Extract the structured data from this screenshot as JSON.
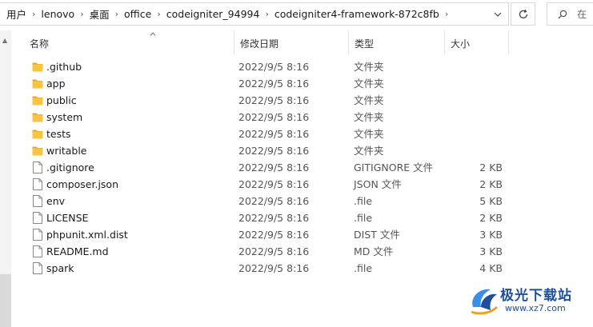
{
  "address": {
    "crumbs": [
      "用户",
      "lenovo",
      "桌面",
      "office",
      "codeigniter_94994",
      "codeigniter4-framework-872c8fb"
    ],
    "separator": "›"
  },
  "search": {
    "placeholder": "在"
  },
  "columns": {
    "name": "名称",
    "date": "修改日期",
    "type": "类型",
    "size": "大小"
  },
  "files": [
    {
      "name": ".github",
      "date": "2022/9/5 8:16",
      "type": "文件夹",
      "size": "",
      "kind": "folder"
    },
    {
      "name": "app",
      "date": "2022/9/5 8:16",
      "type": "文件夹",
      "size": "",
      "kind": "folder"
    },
    {
      "name": "public",
      "date": "2022/9/5 8:16",
      "type": "文件夹",
      "size": "",
      "kind": "folder"
    },
    {
      "name": "system",
      "date": "2022/9/5 8:16",
      "type": "文件夹",
      "size": "",
      "kind": "folder"
    },
    {
      "name": "tests",
      "date": "2022/9/5 8:16",
      "type": "文件夹",
      "size": "",
      "kind": "folder"
    },
    {
      "name": "writable",
      "date": "2022/9/5 8:16",
      "type": "文件夹",
      "size": "",
      "kind": "folder"
    },
    {
      "name": ".gitignore",
      "date": "2022/9/5 8:16",
      "type": "GITIGNORE 文件",
      "size": "2 KB",
      "kind": "file"
    },
    {
      "name": "composer.json",
      "date": "2022/9/5 8:16",
      "type": "JSON 文件",
      "size": "2 KB",
      "kind": "file"
    },
    {
      "name": "env",
      "date": "2022/9/5 8:16",
      "type": ".file",
      "size": "5 KB",
      "kind": "file"
    },
    {
      "name": "LICENSE",
      "date": "2022/9/5 8:16",
      "type": ".file",
      "size": "2 KB",
      "kind": "file"
    },
    {
      "name": "phpunit.xml.dist",
      "date": "2022/9/5 8:16",
      "type": "DIST 文件",
      "size": "3 KB",
      "kind": "file"
    },
    {
      "name": "README.md",
      "date": "2022/9/5 8:16",
      "type": "MD 文件",
      "size": "3 KB",
      "kind": "file"
    },
    {
      "name": "spark",
      "date": "2022/9/5 8:16",
      "type": ".file",
      "size": "4 KB",
      "kind": "file"
    }
  ],
  "watermark": {
    "title": "极光下载站",
    "url": "www.xz7.com"
  },
  "colors": {
    "folder": "#f8c443",
    "folder_dark": "#e9a825",
    "accent": "#1f4f9a"
  }
}
